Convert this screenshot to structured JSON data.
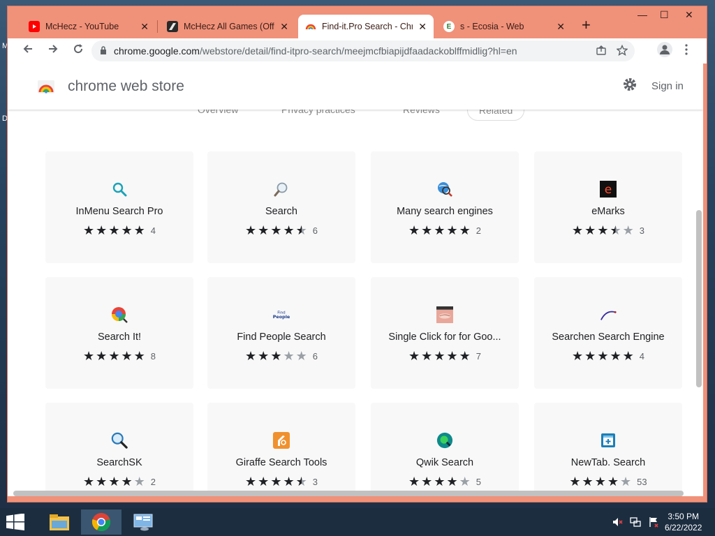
{
  "desktop": {
    "letters": [
      "M",
      "D"
    ]
  },
  "tabs": [
    {
      "title": "McHecz - YouTube",
      "close": "✕",
      "favicon": "youtube-icon"
    },
    {
      "title": "McHecz All Games (Offic",
      "close": "✕",
      "favicon": "game-icon"
    },
    {
      "title": "Find-it.Pro Search - Chro",
      "close": "✕",
      "favicon": "webstore-icon",
      "active": true
    },
    {
      "title": "s - Ecosia - Web",
      "close": "✕",
      "favicon": "ecosia-icon",
      "favicon_letter": "E"
    }
  ],
  "new_tab": "+",
  "window_controls": {
    "minimize": "—",
    "maximize": "☐",
    "close": "✕"
  },
  "address": {
    "host": "chrome.google.com",
    "path": "/webstore/detail/find-itpro-search/meejmcfbiapijdfaadackoblffmidlig?hl=en"
  },
  "store": {
    "name": "chrome web store",
    "sign_in": "Sign in"
  },
  "subnav": {
    "overview": "Overview",
    "privacy": "Privacy practices",
    "reviews": "Reviews",
    "related": "Related"
  },
  "extensions": [
    {
      "name": "InMenu Search Pro",
      "rating": 5,
      "count": "4",
      "icon": "magnifier-teal-icon"
    },
    {
      "name": "Search",
      "rating": 4.5,
      "count": "6",
      "icon": "magnifier-gray-icon"
    },
    {
      "name": "Many search engines",
      "rating": 5,
      "count": "2",
      "icon": "globe-search-icon"
    },
    {
      "name": "eMarks",
      "rating": 3.5,
      "count": "3",
      "icon": "emarks-icon",
      "icon_letter": "e"
    },
    {
      "name": "Search It!",
      "rating": 5,
      "count": "8",
      "icon": "colorful-search-icon"
    },
    {
      "name": "Find People Search",
      "rating": 3,
      "count": "6",
      "icon": "find-people-logo-icon",
      "icon_text": "Find People"
    },
    {
      "name": "Single Click for for Goo...",
      "rating": 5,
      "count": "7",
      "icon": "photo-thumbnail-icon"
    },
    {
      "name": "Searchen Search Engine",
      "rating": 5,
      "count": "4",
      "icon": "swoosh-icon"
    },
    {
      "name": "SearchSK",
      "rating": 4,
      "count": "2",
      "icon": "magnifier-blue-icon"
    },
    {
      "name": "Giraffe Search Tools",
      "rating": 4.5,
      "count": "3",
      "icon": "giraffe-icon"
    },
    {
      "name": "Qwik Search",
      "rating": 4,
      "count": "5",
      "icon": "qwik-icon"
    },
    {
      "name": "NewTab. Search",
      "rating": 4,
      "count": "53",
      "icon": "newtab-search-icon"
    }
  ],
  "taskbar": {
    "items": [
      "file-explorer-icon",
      "chrome-icon",
      "control-panel-icon"
    ],
    "tray": [
      "volume-muted-icon",
      "network-icon",
      "flag-icon"
    ]
  },
  "clock": {
    "time": "3:50 PM",
    "date": "6/22/2022"
  },
  "colors": {
    "window_frame": "#f0917a",
    "taskbar": "#1c2d40",
    "card_bg": "#f8f8f8"
  }
}
